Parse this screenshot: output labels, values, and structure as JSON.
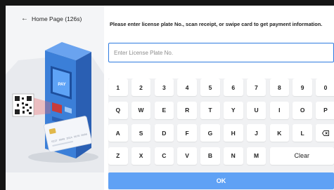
{
  "header": {
    "back_arrow": "←",
    "back_label": "Home Page (126s)"
  },
  "prompt": "Please enter license plate No., scan receipt, or swipe card to get payment information.",
  "plate_input": {
    "placeholder": "Enter License Plate No.",
    "value": ""
  },
  "illustration": {
    "kiosk_screen_text": "PAY",
    "card_text": "6227 0000 2024 5678 0000"
  },
  "keyboard": {
    "rows": [
      [
        "1",
        "2",
        "3",
        "4",
        "5",
        "6",
        "7",
        "8",
        "9",
        "0"
      ],
      [
        "Q",
        "W",
        "E",
        "R",
        "T",
        "Y",
        "U",
        "I",
        "O",
        "P"
      ],
      [
        "A",
        "S",
        "D",
        "F",
        "G",
        "H",
        "J",
        "K",
        "L",
        "backspace-icon"
      ],
      [
        "Z",
        "X",
        "C",
        "V",
        "B",
        "N",
        "M",
        "Clear"
      ]
    ]
  },
  "ok_label": "OK",
  "colors": {
    "accent": "#2d7ae0",
    "ok_button": "#5fa1f5",
    "kiosk": "#3b7fd8",
    "background": "#151515"
  }
}
